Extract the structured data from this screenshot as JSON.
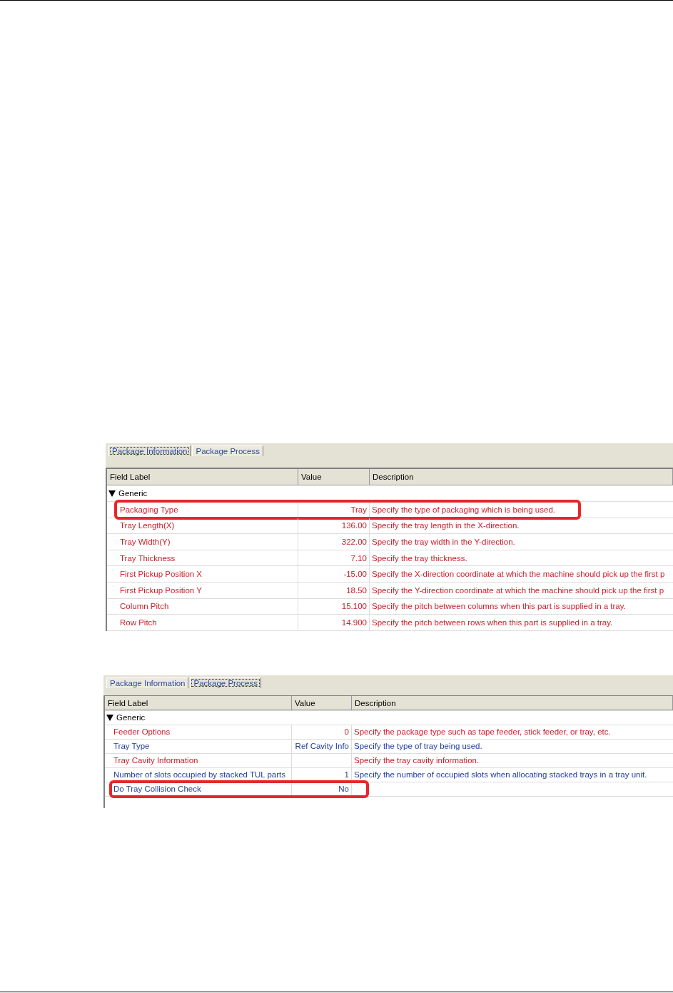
{
  "panels": [
    {
      "tabs": [
        {
          "label": "Package Information",
          "selected": true
        },
        {
          "label": "Package Process",
          "selected": false
        }
      ],
      "columns": [
        "Field Label",
        "Value",
        "Description"
      ],
      "group": {
        "label": "Generic",
        "expanded": true
      },
      "rows": [
        {
          "label": "Packaging Type",
          "value": "Tray",
          "description": "Specify the type of packaging which is being used.",
          "color": "#c8202a",
          "highlighted": true
        },
        {
          "label": "Tray Length(X)",
          "value": "136.00",
          "description": "Specify the tray length in the X-direction.",
          "color": "#c8202a",
          "highlighted": false
        },
        {
          "label": "Tray Width(Y)",
          "value": "322.00",
          "description": "Specify the tray width in the Y-direction.",
          "color": "#c8202a",
          "highlighted": false
        },
        {
          "label": "Tray Thickness",
          "value": "7.10",
          "description": "Specify the tray thickness.",
          "color": "#c8202a",
          "highlighted": false
        },
        {
          "label": "First Pickup Position X",
          "value": "-15.00",
          "description": "Specify the X-direction coordinate at which the machine should pick up the first p",
          "color": "#c8202a",
          "highlighted": false
        },
        {
          "label": "First Pickup Position Y",
          "value": "18.50",
          "description": "Specify the Y-direction coordinate at which the machine should pick up the first p",
          "color": "#c8202a",
          "highlighted": false
        },
        {
          "label": "Column Pitch",
          "value": "15.100",
          "description": "Specify the pitch between columns when this part is supplied in a tray.",
          "color": "#c8202a",
          "highlighted": false
        },
        {
          "label": "Row Pitch",
          "value": "14.900",
          "description": "Specify the pitch between rows when this part is supplied in a tray.",
          "color": "#c8202a",
          "highlighted": false
        }
      ]
    },
    {
      "tabs": [
        {
          "label": "Package Information",
          "selected": false
        },
        {
          "label": "Package Process",
          "selected": true
        }
      ],
      "columns": [
        "Field Label",
        "Value",
        "Description"
      ],
      "group": {
        "label": "Generic",
        "expanded": true
      },
      "rows": [
        {
          "label": "Feeder Options",
          "value": "0",
          "description": "Specify the package type such as tape feeder, stick feeder, or tray, etc.",
          "color": "#c8202a",
          "highlighted": false
        },
        {
          "label": "Tray Type",
          "value": "Ref Cavity Info",
          "description": "Specify the type of tray being used.",
          "color": "#1e3c9a",
          "highlighted": false
        },
        {
          "label": "Tray Cavity Information",
          "value": "",
          "description": "Specify the tray cavity information.",
          "color": "#c8202a",
          "highlighted": false
        },
        {
          "label": "Number of slots occupied by stacked TUL parts",
          "value": "1",
          "description": "Specify the number of occupied slots when allocating stacked trays in a tray unit.",
          "color": "#1e3c9a",
          "highlighted": false
        },
        {
          "label": "Do Tray Collision Check",
          "value": "No",
          "description": "",
          "color": "#1e3c9a",
          "highlighted": true
        }
      ]
    }
  ]
}
